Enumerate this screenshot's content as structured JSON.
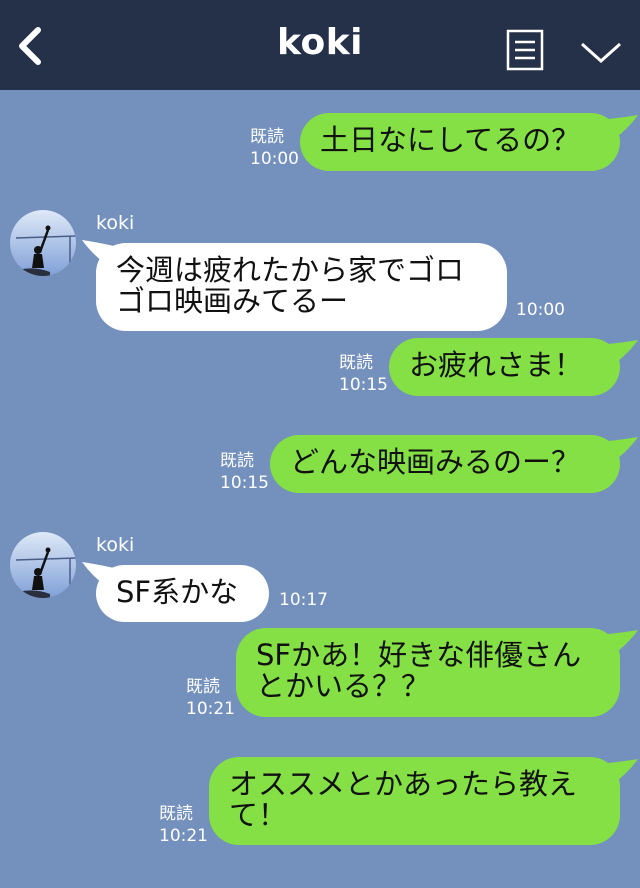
{
  "header": {
    "title": "koki"
  },
  "messages": [
    {
      "text": "土日なにしてるの？",
      "read": "既読",
      "time": "10:00"
    },
    {
      "sender": "koki",
      "line1": "今週は疲れたから家でゴロ",
      "line2": "ゴロ映画みてるー",
      "time": "10:00"
    },
    {
      "text": "お疲れさま！",
      "read": "既読",
      "time": "10:15"
    },
    {
      "text": "どんな映画みるのー？",
      "read": "既読",
      "time": "10:15"
    },
    {
      "sender": "koki",
      "text": "SF系かな",
      "time": "10:17"
    },
    {
      "line1": "SFかあ！好きな俳優さん",
      "line2": "とかいる？？",
      "read": "既読",
      "time": "10:21"
    },
    {
      "line1": "オススメとかあったら教え",
      "line2": "て！",
      "read": "既読",
      "time": "10:21"
    }
  ],
  "colors": {
    "background": "#7490bd",
    "header": "#253149",
    "outgoing": "#84e044",
    "incoming": "#ffffff"
  },
  "icons": [
    "back-icon",
    "menu-icon",
    "chevron-down-icon"
  ]
}
